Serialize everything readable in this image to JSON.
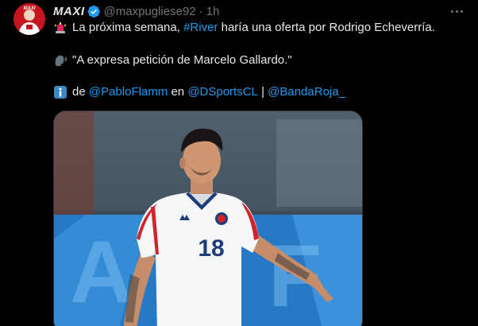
{
  "author": {
    "display_name": "MAXI",
    "handle": "@maxpugliese92",
    "separator": "·",
    "time": "1h",
    "avatar_text": "MAXI",
    "verified_icon": "verified-badge-icon"
  },
  "menu": {
    "more_icon": "more-options-icon"
  },
  "tweet": {
    "line1": {
      "emoji": "siren-emoji-icon",
      "before": "La próxima semana, ",
      "hashtag": "#River",
      "after": " haría una oferta por Rodrigo Echeverría."
    },
    "line2": {
      "emoji": "speaking-head-emoji-icon",
      "text": "\"A expresa petición de Marcelo Gallardo.\""
    },
    "line3": {
      "emoji": "information-emoji-icon",
      "before": "de ",
      "mention1": "@PabloFlamm",
      "middle": " en ",
      "mention2": "@DSportsCL",
      "divider": " | ",
      "mention3": "@BandaRoja_"
    }
  },
  "media": {
    "description_icon": "player-photo",
    "jersey_number": "18"
  },
  "colors": {
    "background": "#000000",
    "text": "#e7e9ea",
    "muted": "#71767b",
    "link": "#1d9bf0",
    "verified": "#1d9bf0"
  }
}
